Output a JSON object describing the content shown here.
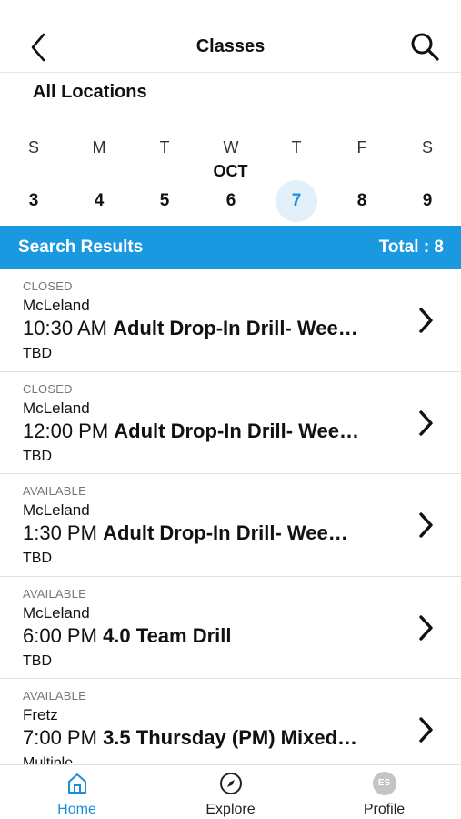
{
  "header": {
    "title": "Classes",
    "back_icon": "chevron-left-icon",
    "search_icon": "search-icon"
  },
  "location": "All Locations",
  "calendar": {
    "month": "OCT",
    "days": [
      {
        "dow": "S",
        "date": "3"
      },
      {
        "dow": "M",
        "date": "4"
      },
      {
        "dow": "T",
        "date": "5"
      },
      {
        "dow": "W",
        "date": "6"
      },
      {
        "dow": "T",
        "date": "7"
      },
      {
        "dow": "F",
        "date": "8"
      },
      {
        "dow": "S",
        "date": "9"
      }
    ],
    "selected_date": "7"
  },
  "results": {
    "label": "Search Results",
    "total": "Total : 8"
  },
  "classes": [
    {
      "status": "CLOSED",
      "location": "McLeland",
      "time": "10:30 AM",
      "name": "Adult Drop-In Drill- Wee…",
      "instructor": "TBD"
    },
    {
      "status": "CLOSED",
      "location": "McLeland",
      "time": "12:00 PM",
      "name": "Adult Drop-In Drill- Wee…",
      "instructor": "TBD"
    },
    {
      "status": "AVAILABLE",
      "location": "McLeland",
      "time": "1:30 PM",
      "name": "Adult Drop-In Drill- Wee…",
      "instructor": "TBD"
    },
    {
      "status": "AVAILABLE",
      "location": "McLeland",
      "time": "6:00 PM",
      "name": "4.0 Team Drill",
      "instructor": "TBD"
    },
    {
      "status": "AVAILABLE",
      "location": "Fretz",
      "time": "7:00 PM",
      "name": "3.5 Thursday (PM) Mixed…",
      "instructor": "Multiple"
    }
  ],
  "tabbar": {
    "tabs": [
      {
        "label": "Home",
        "icon": "home-icon",
        "active": true
      },
      {
        "label": "Explore",
        "icon": "compass-icon",
        "active": false
      },
      {
        "label": "Profile",
        "icon": "avatar",
        "initials": "ES",
        "active": false
      }
    ]
  },
  "colors": {
    "accent": "#1a99e0",
    "selected_day_bg": "#e3f0fa",
    "active_tab": "#1a8fd8"
  }
}
